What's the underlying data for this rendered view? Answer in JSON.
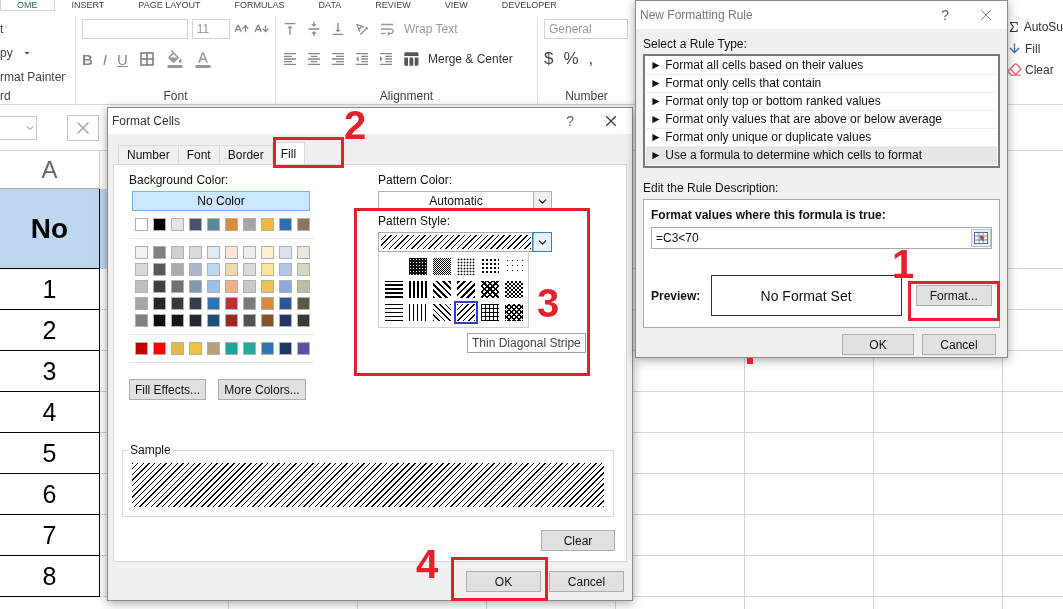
{
  "ribbon": {
    "tabs": [
      {
        "label": "OME",
        "selected": true
      },
      {
        "label": "INSERT",
        "selected": false
      },
      {
        "label": "PAGE LAYOUT",
        "selected": false
      },
      {
        "label": "FORMULAS",
        "selected": false
      },
      {
        "label": "DATA",
        "selected": false
      },
      {
        "label": "REVIEW",
        "selected": false
      },
      {
        "label": "VIEW",
        "selected": false
      },
      {
        "label": "DEVELOPER",
        "selected": false
      }
    ],
    "clipboard": {
      "cut": "t",
      "copy": "py",
      "painter": "rmat Painter",
      "group_label": "rd"
    },
    "font": {
      "size": "11",
      "bold": "B",
      "italic": "I",
      "underline": "U",
      "group_label": "Font"
    },
    "alignment": {
      "wrap_text": "Wrap Text",
      "merge_center": "Merge & Center",
      "group_label": "Alignment"
    },
    "number": {
      "format": "General",
      "currency": "$",
      "percent": "%",
      "comma": ",",
      "group_label": "Number"
    },
    "editing": {
      "autosum": "AutoSu",
      "fill": "Fill",
      "clear": "Clear"
    }
  },
  "sheet": {
    "column_header": "A",
    "header": "No",
    "rows": [
      "1",
      "2",
      "3",
      "4",
      "5",
      "6",
      "7",
      "8"
    ]
  },
  "format_cells": {
    "title": "Format Cells",
    "help": "?",
    "tabs": [
      {
        "label": "Number",
        "selected": false
      },
      {
        "label": "Font",
        "selected": false
      },
      {
        "label": "Border",
        "selected": false
      },
      {
        "label": "Fill",
        "selected": true
      }
    ],
    "background_color_label": "Background Color:",
    "no_color": "No Color",
    "swatch_groups": [
      {
        "rows": [
          [
            {
              "color": "#ffffff"
            },
            {
              "color": "#000000"
            },
            {
              "color": "#e7e6e6"
            },
            {
              "color": "#44546a"
            },
            {
              "color": "#5a8a9a"
            },
            {
              "color": "#dd8a3c"
            },
            {
              "color": "#a5a5a5"
            },
            {
              "color": "#f0b73d"
            },
            {
              "color": "#2e6fb4"
            },
            {
              "color": "#8c7657"
            }
          ]
        ]
      },
      {
        "rows": [
          [
            {
              "color": "#f2f2f2"
            },
            {
              "color": "#808080"
            },
            {
              "color": "#d0cece"
            },
            {
              "color": "#d6dce4"
            },
            {
              "color": "#ddebf7"
            },
            {
              "color": "#fce4d6"
            },
            {
              "color": "#ededed"
            },
            {
              "color": "#fff2cc"
            },
            {
              "color": "#d9e1f2"
            },
            {
              "color": "#e8e8dc"
            }
          ],
          [
            {
              "color": "#d9d9d9"
            },
            {
              "color": "#595959"
            },
            {
              "color": "#aeaaaa"
            },
            {
              "color": "#acb9ca"
            },
            {
              "color": "#bdd7ee"
            },
            {
              "color": "#f0d8b0"
            },
            {
              "color": "#dbdbdb"
            },
            {
              "color": "#ffe699"
            },
            {
              "color": "#b4c6e7"
            },
            {
              "color": "#d4d8c4"
            }
          ],
          [
            {
              "color": "#bfbfbf"
            },
            {
              "color": "#404040"
            },
            {
              "color": "#757171"
            },
            {
              "color": "#8497b0"
            },
            {
              "color": "#9bc2e6"
            },
            {
              "color": "#f4b084"
            },
            {
              "color": "#c9c9c9"
            },
            {
              "color": "#f0c050"
            },
            {
              "color": "#8ea9db"
            },
            {
              "color": "#b8c0a0"
            }
          ],
          [
            {
              "color": "#a6a6a6"
            },
            {
              "color": "#262626"
            },
            {
              "color": "#3a3838"
            },
            {
              "color": "#333f4f"
            },
            {
              "color": "#2f75b5"
            },
            {
              "color": "#c03030"
            },
            {
              "color": "#7b7b7b"
            },
            {
              "color": "#d88a38"
            },
            {
              "color": "#305496"
            },
            {
              "color": "#5a5a48"
            }
          ],
          [
            {
              "color": "#808080"
            },
            {
              "color": "#0d0d0d"
            },
            {
              "color": "#161616"
            },
            {
              "color": "#222b35"
            },
            {
              "color": "#1f4e78"
            },
            {
              "color": "#a02818"
            },
            {
              "color": "#525252"
            },
            {
              "color": "#8a5028"
            },
            {
              "color": "#203764"
            },
            {
              "color": "#3a3a30"
            }
          ]
        ]
      },
      {
        "rows": [
          [
            {
              "color": "#c00000"
            },
            {
              "color": "#ff0000"
            },
            {
              "color": "#e8b84a"
            },
            {
              "color": "#f0c040"
            },
            {
              "color": "#b3a27a"
            },
            {
              "color": "#1ca39a"
            },
            {
              "color": "#2aa89a"
            },
            {
              "color": "#2e75b6"
            },
            {
              "color": "#1f3864"
            },
            {
              "color": "#5a4fa8"
            }
          ]
        ]
      }
    ],
    "fill_effects": "Fill Effects...",
    "more_colors": "More Colors...",
    "pattern_color_label": "Pattern Color:",
    "pattern_color": "Automatic",
    "pattern_style_label": "Pattern Style:",
    "patterns": [
      {
        "kind": "none",
        "selected": false
      },
      {
        "kind": "gray75",
        "selected": false
      },
      {
        "kind": "gray50",
        "selected": false
      },
      {
        "kind": "gray25",
        "selected": false
      },
      {
        "kind": "gray12",
        "selected": false
      },
      {
        "kind": "gray6",
        "selected": false
      },
      {
        "kind": "hstripe",
        "selected": false
      },
      {
        "kind": "vstripe",
        "selected": false
      },
      {
        "kind": "rdiag",
        "selected": false
      },
      {
        "kind": "diag",
        "selected": false
      },
      {
        "kind": "diagcross",
        "selected": false
      },
      {
        "kind": "thickcross",
        "selected": false
      },
      {
        "kind": "thinh",
        "selected": false
      },
      {
        "kind": "thinv",
        "selected": false
      },
      {
        "kind": "thinrdiag",
        "selected": false
      },
      {
        "kind": "thindiag",
        "selected": true
      },
      {
        "kind": "thingrid",
        "selected": false
      },
      {
        "kind": "thindiagcross",
        "selected": false
      }
    ],
    "tooltip": "Thin Diagonal Stripe",
    "sample_label": "Sample",
    "clear": "Clear",
    "ok": "OK",
    "cancel": "Cancel"
  },
  "rule_dialog": {
    "title": "New Formatting Rule",
    "help": "?",
    "rule_type_label": "Select a Rule Type:",
    "rule_types": [
      {
        "label": "► Format all cells based on their values",
        "selected": false
      },
      {
        "label": "► Format only cells that contain",
        "selected": false
      },
      {
        "label": "► Format only top or bottom ranked values",
        "selected": false
      },
      {
        "label": "► Format only values that are above or below average",
        "selected": false
      },
      {
        "label": "► Format only unique or duplicate values",
        "selected": false
      },
      {
        "label": "► Use a formula to determine which cells to format",
        "selected": true
      }
    ],
    "description_label": "Edit the Rule Description:",
    "formula_label": "Format values where this formula is true:",
    "formula": "=C3<70",
    "preview_label": "Preview:",
    "preview": "No Format Set",
    "format_button": "Format...",
    "ok": "OK",
    "cancel": "Cancel"
  },
  "annotations": [
    {
      "number": "1"
    },
    {
      "number": "2"
    },
    {
      "number": "3"
    },
    {
      "number": "4"
    }
  ]
}
